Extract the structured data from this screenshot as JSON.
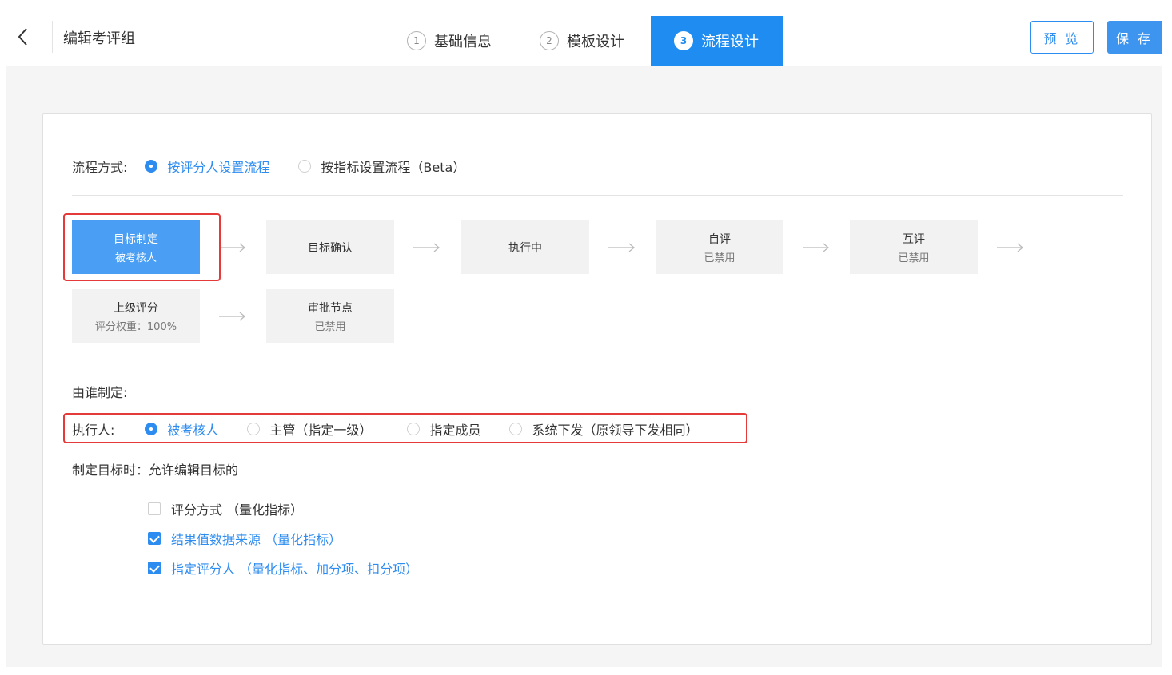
{
  "header": {
    "title": "编辑考评组",
    "steps": [
      {
        "num": "1",
        "label": "基础信息"
      },
      {
        "num": "2",
        "label": "模板设计"
      },
      {
        "num": "3",
        "label": "流程设计"
      }
    ],
    "preview_label": "预 览",
    "save_label": "保 存"
  },
  "mode": {
    "label": "流程方式:",
    "options": [
      "按评分人设置流程",
      "按指标设置流程（Beta）"
    ],
    "selected": "按评分人设置流程"
  },
  "flow": {
    "nodes": [
      {
        "title": "目标制定",
        "sub": "被考核人",
        "active": true
      },
      {
        "title": "目标确认",
        "sub": ""
      },
      {
        "title": "执行中",
        "sub": ""
      },
      {
        "title": "自评",
        "sub": "已禁用"
      },
      {
        "title": "互评",
        "sub": "已禁用"
      },
      {
        "title": "上级评分",
        "sub": "评分权重：100%"
      },
      {
        "title": "审批节点",
        "sub": "已禁用"
      }
    ]
  },
  "who": {
    "label": "由谁制定:"
  },
  "executor": {
    "label": "执行人:",
    "options": [
      "被考核人",
      "主管（指定一级）",
      "指定成员",
      "系统下发（原领导下发相同）"
    ],
    "selected": "被考核人"
  },
  "goal": {
    "label": "制定目标时：允许编辑目标的",
    "checks": [
      {
        "label": "评分方式 （量化指标）",
        "checked": false
      },
      {
        "label": "结果值数据来源 （量化指标）",
        "checked": true
      },
      {
        "label": "指定评分人 （量化指标、加分项、扣分项）",
        "checked": true
      }
    ]
  },
  "colors": {
    "accent": "#2d8cf0",
    "active_step": "#1e8cf0",
    "highlight": "#e43a3a"
  },
  "icons": {
    "back": "chevron-left-icon",
    "arrow": "arrow-right-icon"
  }
}
